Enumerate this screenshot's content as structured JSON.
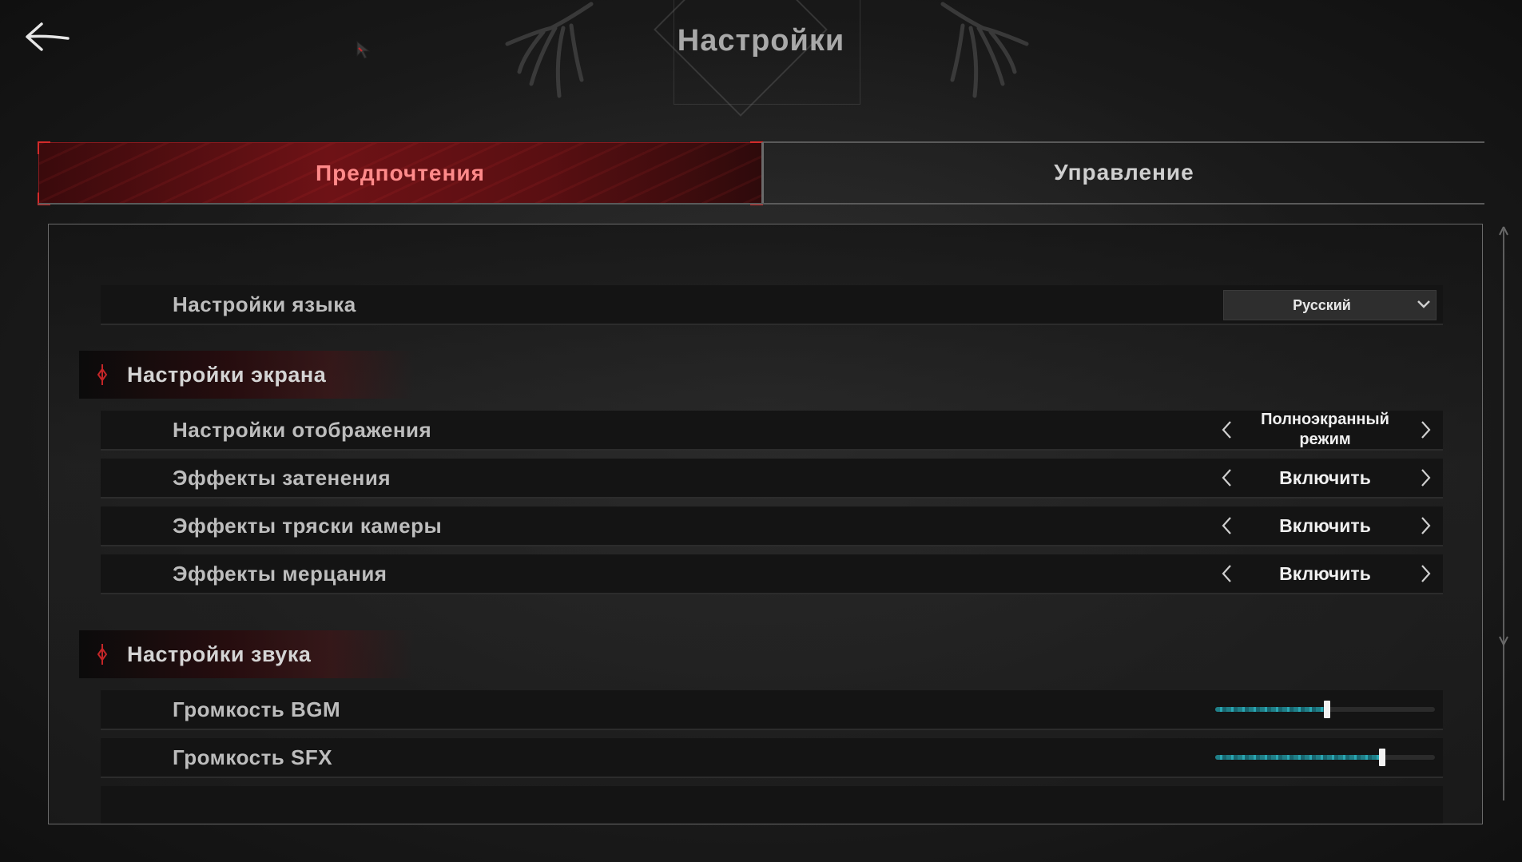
{
  "header": {
    "title": "Настройки"
  },
  "tabs": [
    {
      "label": "Предпочтения",
      "active": true
    },
    {
      "label": "Управление",
      "active": false
    }
  ],
  "language": {
    "label": "Настройки языка",
    "value": "Русский"
  },
  "display_section": {
    "title": "Настройки экрана",
    "rows": [
      {
        "label": "Настройки отображения",
        "value": "Полноэкранный режим"
      },
      {
        "label": "Эффекты затенения",
        "value": "Включить"
      },
      {
        "label": "Эффекты тряски камеры",
        "value": "Включить"
      },
      {
        "label": "Эффекты мерцания",
        "value": "Включить"
      }
    ]
  },
  "sound_section": {
    "title": "Настройки звука",
    "rows": [
      {
        "label": "Громкость BGM",
        "level": 0.51
      },
      {
        "label": "Громкость SFX",
        "level": 0.76
      }
    ]
  },
  "colors": {
    "accent_red": "#d42a2a",
    "slider_fill": "#2aa6b2",
    "text": "#bdbdbd"
  },
  "icons": {
    "back": "back-arrow-icon",
    "left": "chevron-left-icon",
    "right": "chevron-right-icon",
    "dropdown": "chevron-down-icon"
  }
}
